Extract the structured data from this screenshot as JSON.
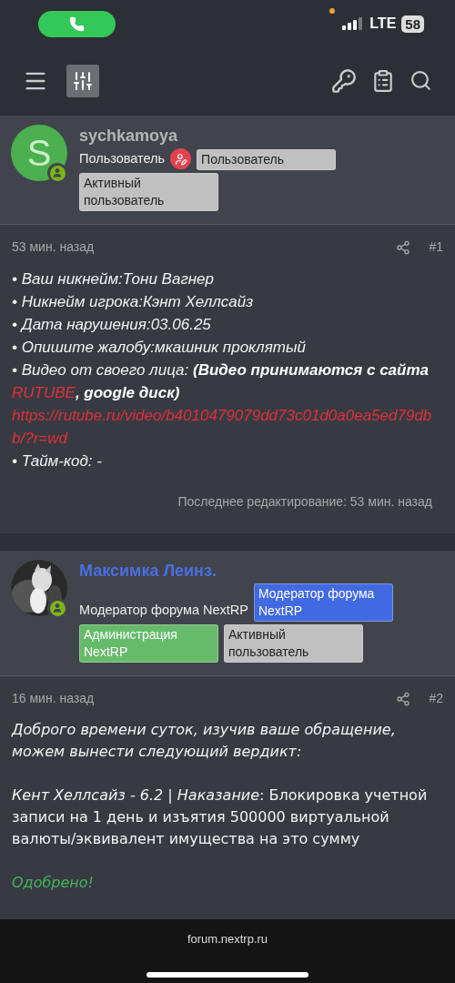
{
  "status_bar": {
    "network": "LTE",
    "battery": "58"
  },
  "posts": [
    {
      "kind": "complaint",
      "author": {
        "name": "sychkamoya",
        "avatar": {
          "kind": "letter",
          "initial": "S"
        },
        "color": "#b5b5b5",
        "title": "Пользователь",
        "title_icon": true,
        "badges": [
          {
            "label": "Пользователь",
            "color": "#c0c0c0"
          },
          {
            "label": "Активный пользователь",
            "color": "#c0c0c0"
          }
        ]
      },
      "time": "53 мин. назад",
      "number": "#1",
      "paragraphs": [
        [
          {
            "text": "• Ваш никнейм:Тони Вагнер",
            "kind": "emphasis"
          }
        ],
        [
          {
            "text": "• Никнейм игрока:Кэнт Хеллсайз",
            "kind": "emphasis"
          }
        ],
        [
          {
            "text": "• Дата нарушения:03.06.25",
            "kind": "emphasis"
          }
        ],
        [
          {
            "text": "• Опишите жалобу:мкашник проклятый",
            "kind": "emphasis"
          }
        ],
        [
          {
            "text": "• Видео от своего лица: ",
            "kind": "emphasis"
          },
          {
            "text": "(Видео принимаются с сайта ",
            "kind": "strong"
          },
          {
            "text": "RUTUBE",
            "kind": "highlight"
          },
          {
            "text": ", google диск)",
            "kind": "strong"
          }
        ],
        [
          {
            "text": "https://rutube.ru/video/b4010479079dd73c01d0a0ea5ed79dbb/?r=wd",
            "kind": "link"
          }
        ],
        [
          {
            "text": "• Тайм-код: -",
            "kind": "emphasis"
          }
        ]
      ],
      "edited": "Последнее редактирование: 53 мин. назад"
    },
    {
      "kind": "reply",
      "author": {
        "name": "Максимка Леинз.",
        "color": "#4a6fe0",
        "title": "Модератор форума NextRP",
        "title_icon": false,
        "badges": [
          {
            "label": "Модератор форума NextRP",
            "color": "#4169e1"
          },
          {
            "label": "Администрация NextRP",
            "color": "#66bb6a"
          },
          {
            "label": "Активный пользователь",
            "color": "#c0c0c0"
          }
        ]
      },
      "time": "16 мин. назад",
      "number": "#2",
      "paragraphs": [
        [
          {
            "text": "Доброго времени суток, изучив ваше обращение, можем вынести следующий вердикт:",
            "kind": "emphasis"
          }
        ],
        [
          {
            "text": "Кент Хеллсайз - 6.2 | Наказание",
            "kind": "emphasis"
          },
          {
            "text": ": Блокировка учетной записи на 1 день и изъятия 500000 виртуальной валюты/эквивалент имущества на это сумму",
            "kind": "text"
          }
        ],
        [
          {
            "text": "Одобрено!",
            "kind": "status"
          }
        ]
      ]
    }
  ],
  "browser": {
    "url": "forum.nextrp.ru"
  }
}
